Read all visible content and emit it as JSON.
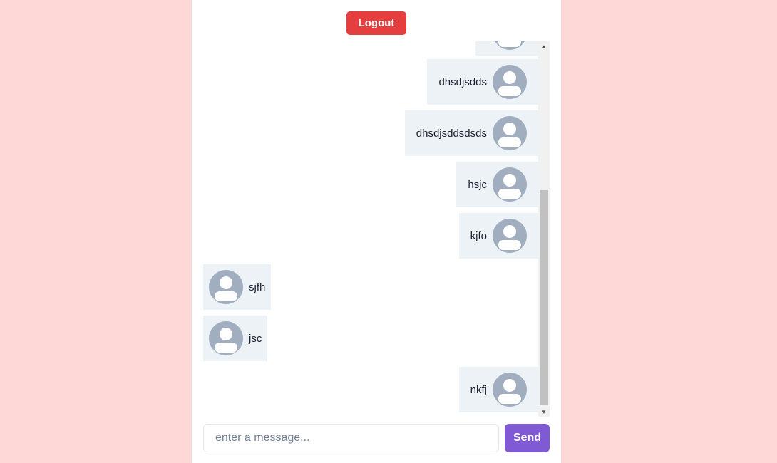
{
  "header": {
    "logout_label": "Logout"
  },
  "messages": [
    {
      "text": "",
      "side": "right",
      "avatar_icon": "user-avatar-icon"
    },
    {
      "text": "dhsdjsdds",
      "side": "right",
      "avatar_icon": "user-avatar-icon"
    },
    {
      "text": "dhsdjsddsdsds",
      "side": "right",
      "avatar_icon": "user-avatar-icon"
    },
    {
      "text": "hsjc",
      "side": "right",
      "avatar_icon": "user-avatar-icon"
    },
    {
      "text": "kjfo",
      "side": "right",
      "avatar_icon": "user-avatar-icon"
    },
    {
      "text": "sjfh",
      "side": "left",
      "avatar_icon": "user-avatar-icon"
    },
    {
      "text": "jsc",
      "side": "left",
      "avatar_icon": "user-avatar-icon"
    },
    {
      "text": "nkfj",
      "side": "right",
      "avatar_icon": "user-avatar-icon"
    }
  ],
  "composer": {
    "input_value": "",
    "input_placeholder": "enter a message...",
    "send_label": "Send"
  },
  "colors": {
    "page_background": "#fed7d7",
    "logout": "#e53e3e",
    "send": "#805ad5",
    "bubble": "#edf2f7",
    "avatar": "#a0aec0"
  }
}
